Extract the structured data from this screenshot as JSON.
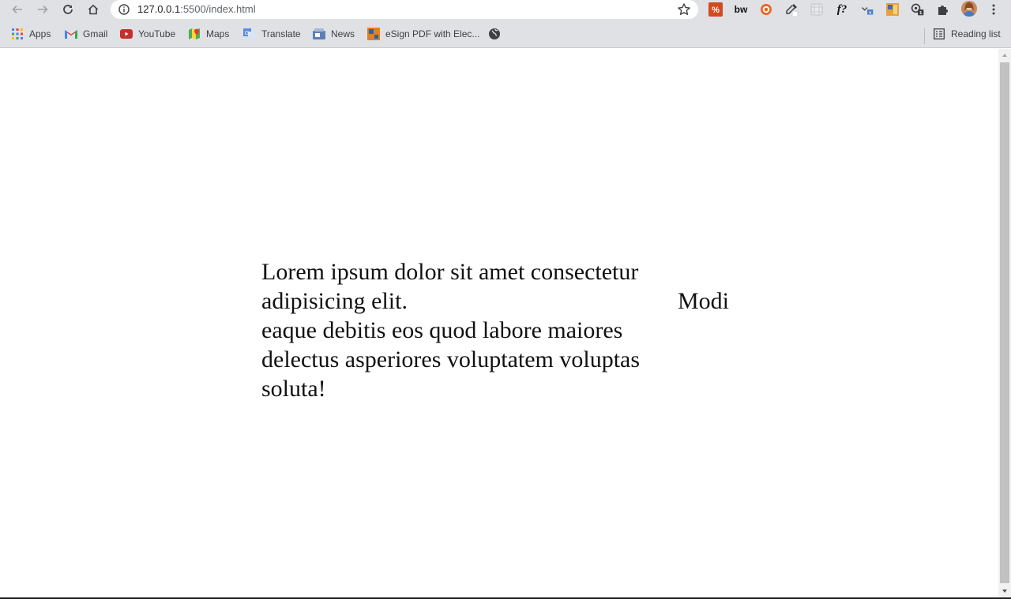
{
  "browser": {
    "url_host": "127.0.0.1",
    "url_path": ":5500/index.html",
    "extensions": [
      "tampermonkey-icon",
      "bw-icon",
      "target-icon",
      "eyedropper-icon",
      "grid-icon",
      "f-icon",
      "translate-icon",
      "bookmark-manager-icon",
      "update-icon",
      "puzzle-icon",
      "avatar"
    ],
    "ext_labels": {
      "bw": "bw",
      "f": "f?"
    }
  },
  "bookmarks": {
    "apps": "Apps",
    "gmail": "Gmail",
    "youtube": "YouTube",
    "maps": "Maps",
    "translate": "Translate",
    "news": "News",
    "esign": "eSign PDF with Elec...",
    "reading_list": "Reading list"
  },
  "page": {
    "paragraph": "Lorem ipsum dolor sit amet consectetur adipisicing elit. eaque debitis eos quod labore maiores delectus asperiores voluptatem voluptas soluta!",
    "line1": "Lorem ipsum dolor sit amet consectetur",
    "line2": "adipisicing elit.",
    "line3": "eaque debitis eos quod labore maiores",
    "line4": "delectus asperiores voluptatem voluptas",
    "line5": "soluta!",
    "side_word": "Modi"
  }
}
